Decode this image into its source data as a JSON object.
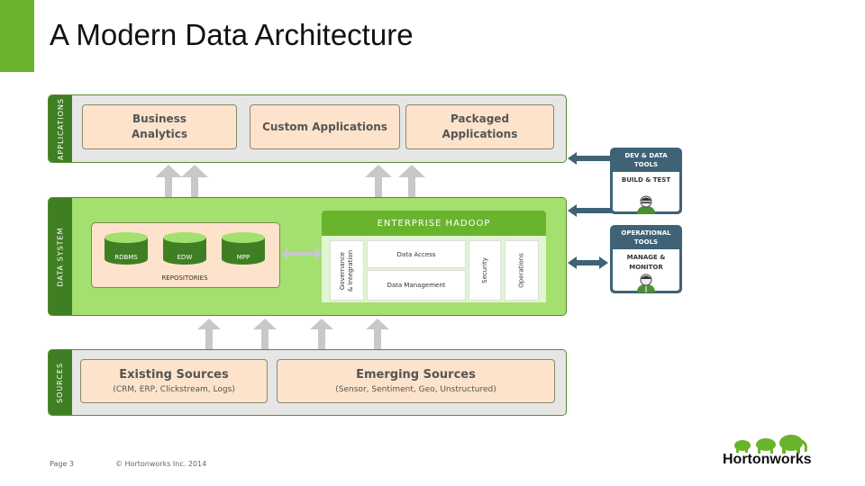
{
  "title": "A Modern Data Architecture",
  "colors": {
    "brand_green": "#6ab42d",
    "dark_green": "#3f7f23",
    "light_green": "#a3e070",
    "peach": "#fde3cc",
    "slate": "#3f6276",
    "arrow_gray": "#c8c8c8"
  },
  "applications": {
    "label": "APPLICATIONS",
    "boxes": [
      {
        "line1": "Business",
        "line2": "Analytics"
      },
      {
        "line1": "Custom Applications",
        "line2": ""
      },
      {
        "line1": "Packaged",
        "line2": "Applications"
      }
    ]
  },
  "data_system": {
    "label": "DATA SYSTEM",
    "repositories": {
      "label": "REPOSITORIES",
      "items": [
        "RDBMS",
        "EDW",
        "MPP"
      ]
    },
    "hadoop": {
      "title": "ENTERPRISE HADOOP",
      "governance": [
        "Governance",
        "& Integration"
      ],
      "data_access": "Data Access",
      "data_management": "Data Management",
      "security": "Security",
      "operations": "Operations"
    }
  },
  "sources": {
    "label": "SOURCES",
    "boxes": [
      {
        "title": "Existing Sources",
        "subtitle": "(CRM, ERP, Clickstream, Logs)"
      },
      {
        "title": "Emerging Sources",
        "subtitle": "(Sensor, Sentiment, Geo, Unstructured)"
      }
    ]
  },
  "tools": [
    {
      "header": [
        "DEV & DATA",
        "TOOLS"
      ],
      "body": [
        "BUILD & TEST"
      ],
      "icon": "developer-person-icon"
    },
    {
      "header": [
        "OPERATIONAL",
        "TOOLS"
      ],
      "body": [
        "MANAGE &",
        "MONITOR"
      ],
      "icon": "operator-person-icon"
    }
  ],
  "footer": {
    "page": "Page 3",
    "copyright": "© Hortonworks Inc. 2014"
  },
  "logo": {
    "text": "Hortonworks",
    "icon": "elephants-logo-icon"
  }
}
